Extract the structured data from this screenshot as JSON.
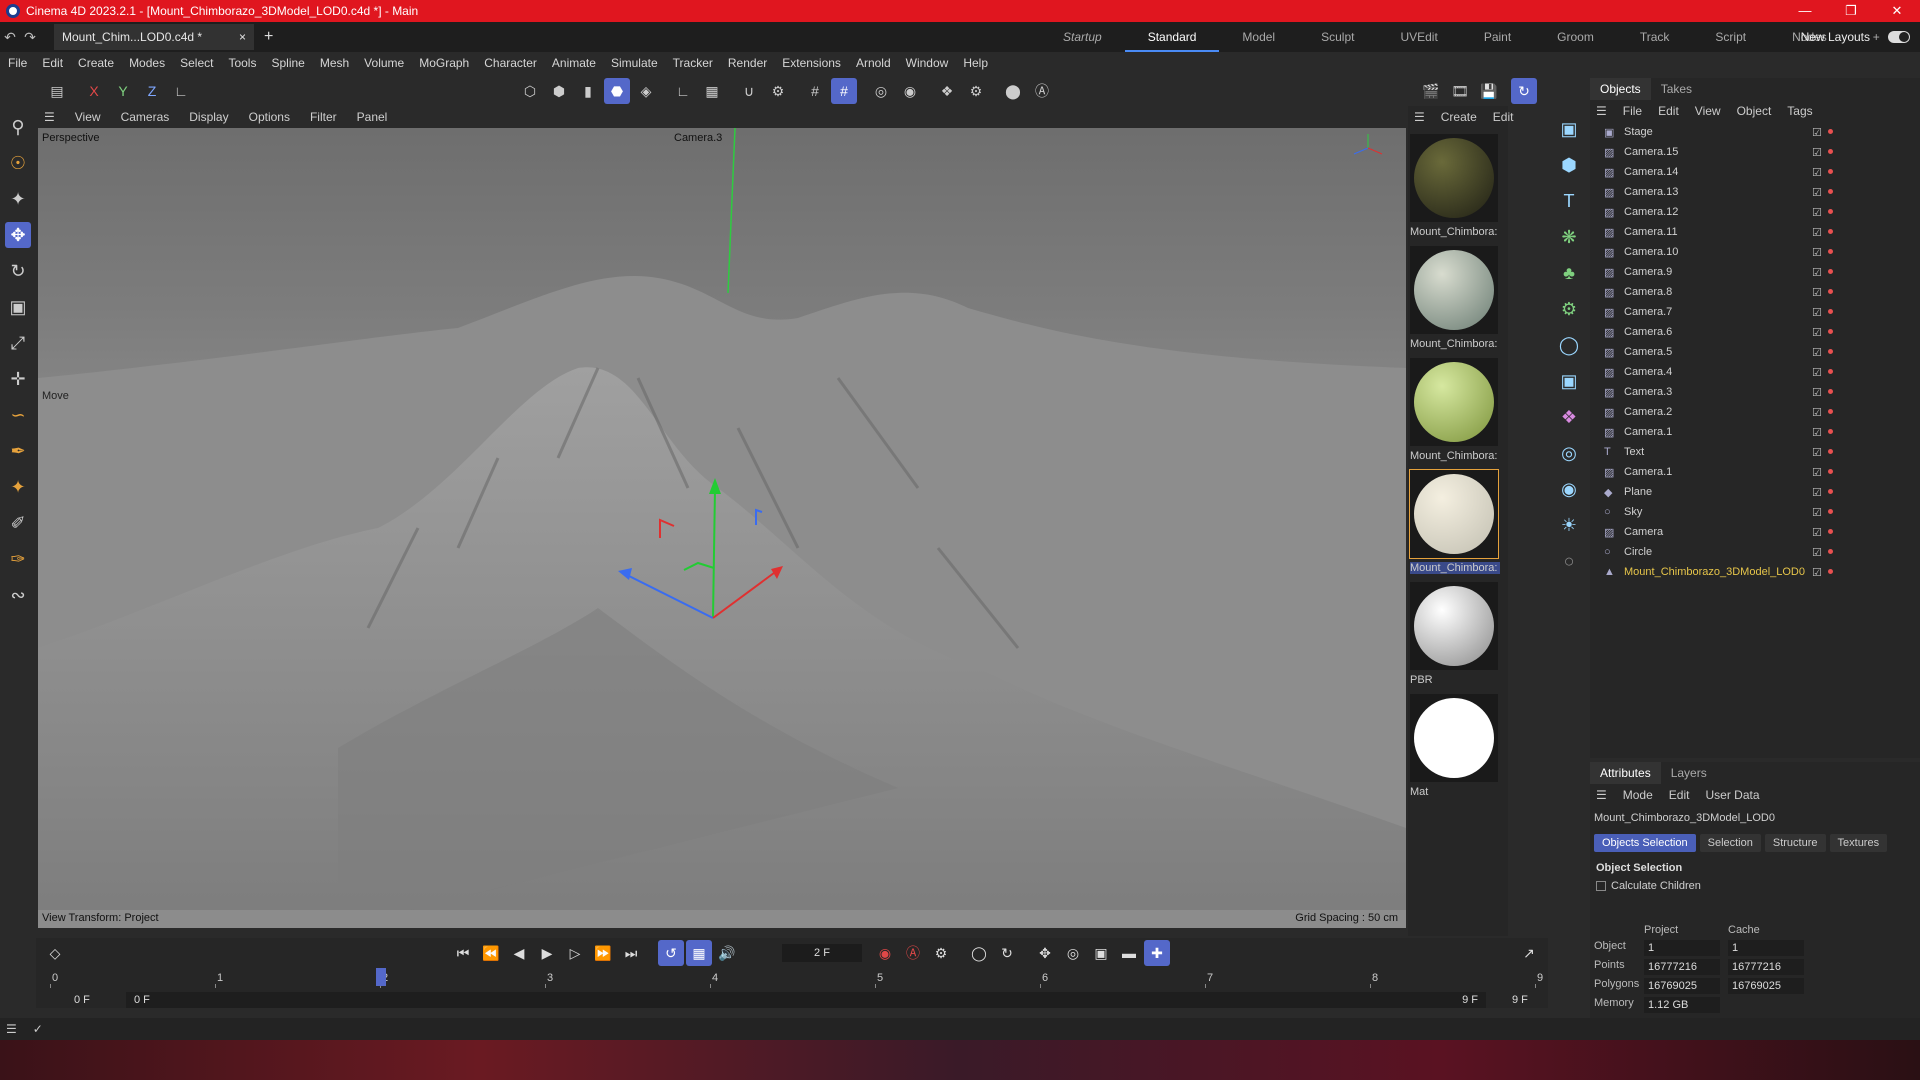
{
  "window": {
    "title": "Cinema 4D 2023.2.1 - [Mount_Chimborazo_3DModel_LOD0.c4d *] - Main",
    "controls": [
      "—",
      "❐",
      "✕"
    ]
  },
  "tabbar": {
    "doc_tab": "Mount_Chim...LOD0.c4d *",
    "doc_close": "×",
    "new_tab": "+",
    "layouts": [
      {
        "label": "Startup",
        "italic": true
      },
      {
        "label": "Standard",
        "active": true
      },
      {
        "label": "Model"
      },
      {
        "label": "Sculpt"
      },
      {
        "label": "UVEdit"
      },
      {
        "label": "Paint"
      },
      {
        "label": "Groom"
      },
      {
        "label": "Track"
      },
      {
        "label": "Script"
      },
      {
        "label": "Nodes"
      },
      {
        "label": "+"
      }
    ],
    "new_layouts": "New Layouts"
  },
  "menubar": [
    "File",
    "Edit",
    "Create",
    "Modes",
    "Select",
    "Tools",
    "Spline",
    "Mesh",
    "Volume",
    "MoGraph",
    "Character",
    "Animate",
    "Simulate",
    "Tracker",
    "Render",
    "Extensions",
    "Arnold",
    "Window",
    "Help"
  ],
  "toolbar_axes": [
    "X",
    "Y",
    "Z"
  ],
  "viewport": {
    "menu": [
      "View",
      "Cameras",
      "Display",
      "Options",
      "Filter",
      "Panel"
    ],
    "projection": "Perspective",
    "camera": "Camera.3",
    "tool_label": "Move",
    "status_left": "View Transform: Project",
    "status_right": "Grid Spacing : 50 cm"
  },
  "materials": {
    "menu": [
      "Create",
      "Edit"
    ],
    "items": [
      {
        "label": "Mount_Chimbora:",
        "color1": "#6a6a3a",
        "color2": "#2a2a1a"
      },
      {
        "label": "Mount_Chimbora:",
        "color1": "#d8dccf",
        "color2": "#7a8a80"
      },
      {
        "label": "Mount_Chimbora:",
        "color1": "#d6e8a0",
        "color2": "#8aa04a"
      },
      {
        "label": "Mount_Chimbora:",
        "color1": "#f4efe0",
        "color2": "#c9c6b8",
        "selected": true
      },
      {
        "label": "PBR",
        "color1": "#ffffff",
        "color2": "#9a9a9a"
      },
      {
        "label": "Mat",
        "color1": "#ffffff",
        "color2": "#ffffff"
      }
    ]
  },
  "objects": {
    "tabs": [
      "Objects",
      "Takes"
    ],
    "menu": [
      "File",
      "Edit",
      "View",
      "Object",
      "Tags"
    ],
    "items": [
      {
        "name": "Stage",
        "icon": "▣"
      },
      {
        "name": "Camera.15",
        "icon": "▨"
      },
      {
        "name": "Camera.14",
        "icon": "▨"
      },
      {
        "name": "Camera.13",
        "icon": "▨"
      },
      {
        "name": "Camera.12",
        "icon": "▨"
      },
      {
        "name": "Camera.11",
        "icon": "▨"
      },
      {
        "name": "Camera.10",
        "icon": "▨"
      },
      {
        "name": "Camera.9",
        "icon": "▨"
      },
      {
        "name": "Camera.8",
        "icon": "▨"
      },
      {
        "name": "Camera.7",
        "icon": "▨"
      },
      {
        "name": "Camera.6",
        "icon": "▨"
      },
      {
        "name": "Camera.5",
        "icon": "▨"
      },
      {
        "name": "Camera.4",
        "icon": "▨"
      },
      {
        "name": "Camera.3",
        "icon": "▨"
      },
      {
        "name": "Camera.2",
        "icon": "▨"
      },
      {
        "name": "Camera.1",
        "icon": "▨"
      },
      {
        "name": "Text",
        "icon": "T"
      },
      {
        "name": "Camera.1",
        "icon": "▨"
      },
      {
        "name": "Plane",
        "icon": "◆"
      },
      {
        "name": "Sky",
        "icon": "○"
      },
      {
        "name": "Camera",
        "icon": "▨"
      },
      {
        "name": "Circle",
        "icon": "○"
      },
      {
        "name": "Mount_Chimborazo_3DModel_LOD0",
        "icon": "▲",
        "selected": true
      }
    ]
  },
  "attributes": {
    "tabs": [
      "Attributes",
      "Layers"
    ],
    "menu": [
      "Mode",
      "Edit",
      "User Data"
    ],
    "object_name": "Mount_Chimborazo_3DModel_LOD0",
    "buttons": [
      {
        "label": "Objects Selection",
        "on": true
      },
      {
        "label": "Selection"
      },
      {
        "label": "Structure"
      },
      {
        "label": "Textures"
      }
    ],
    "section": "Object Selection",
    "checkbox": "Calculate Children",
    "col_project": "Project",
    "col_cache": "Cache",
    "rows": [
      {
        "label": "Object",
        "project": "1",
        "cache": "1"
      },
      {
        "label": "Points",
        "project": "16777216",
        "cache": "16777216"
      },
      {
        "label": "Polygons",
        "project": "16769025",
        "cache": "16769025"
      },
      {
        "label": "Memory",
        "project": "1.12 GB",
        "cache": ""
      }
    ]
  },
  "timeline": {
    "current_frame": "2 F",
    "ruler": [
      "0",
      "1",
      "2",
      "3",
      "4",
      "5",
      "6",
      "7",
      "8",
      "9"
    ],
    "start_left": "0 F",
    "start_field": "0 F",
    "end_field": "9 F",
    "end_right": "9 F"
  },
  "colors": {
    "titlebar": "#e0161f",
    "accent": "#5468c9",
    "selected_object": "#e6c54a"
  }
}
